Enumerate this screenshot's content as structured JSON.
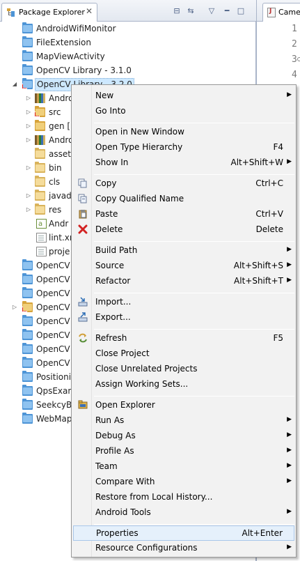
{
  "explorer": {
    "tab_title": "Package Explorer",
    "tab_close": "✕",
    "toolbar": {
      "collapse": "⊟",
      "link": "⇆",
      "menu": "▽",
      "minimize": "━",
      "maximize": "□"
    },
    "tree": [
      "AndroidWifiMonitor",
      "FileExtension",
      "MapViewActivity",
      "OpenCV Library - 3.1.0",
      "OpenCV Library - 3.2.0",
      "Andro",
      "src",
      "gen [",
      "Andro",
      "asset",
      "bin",
      "cls",
      "javad",
      "res",
      "Andr",
      "lint.xr",
      "proje",
      "OpenCV",
      "OpenCV",
      "OpenCV",
      "OpenCV",
      "OpenCV",
      "OpenCV",
      "OpenCV",
      "OpenCV",
      "Positioni",
      "QpsExan",
      "SeekcyB",
      "WebMap"
    ]
  },
  "editor": {
    "tab_title": "Came",
    "line_numbers": [
      "1",
      "2",
      "3",
      "4"
    ]
  },
  "menu": {
    "new": "New",
    "go_into": "Go Into",
    "open_new_window": "Open in New Window",
    "open_type_hierarchy": "Open Type Hierarchy",
    "open_type_hierarchy_key": "F4",
    "show_in": "Show In",
    "show_in_key": "Alt+Shift+W",
    "copy": "Copy",
    "copy_key": "Ctrl+C",
    "copy_qualified": "Copy Qualified Name",
    "paste": "Paste",
    "paste_key": "Ctrl+V",
    "delete": "Delete",
    "delete_key": "Delete",
    "build_path": "Build Path",
    "source": "Source",
    "source_key": "Alt+Shift+S",
    "refactor": "Refactor",
    "refactor_key": "Alt+Shift+T",
    "import": "Import...",
    "export": "Export...",
    "refresh": "Refresh",
    "refresh_key": "F5",
    "close_project": "Close Project",
    "close_unrelated": "Close Unrelated Projects",
    "assign_working_sets": "Assign Working Sets...",
    "open_explorer": "Open Explorer",
    "run_as": "Run As",
    "debug_as": "Debug As",
    "profile_as": "Profile As",
    "team": "Team",
    "compare_with": "Compare With",
    "restore_history": "Restore from Local History...",
    "android_tools": "Android Tools",
    "properties": "Properties",
    "properties_key": "Alt+Enter",
    "resource_configurations": "Resource Configurations"
  },
  "colors": {
    "selection": "#cde8ff",
    "menu_highlight": "#e5f0fb",
    "folder_blue": "#4d94d6",
    "delete_red": "#d22222"
  }
}
